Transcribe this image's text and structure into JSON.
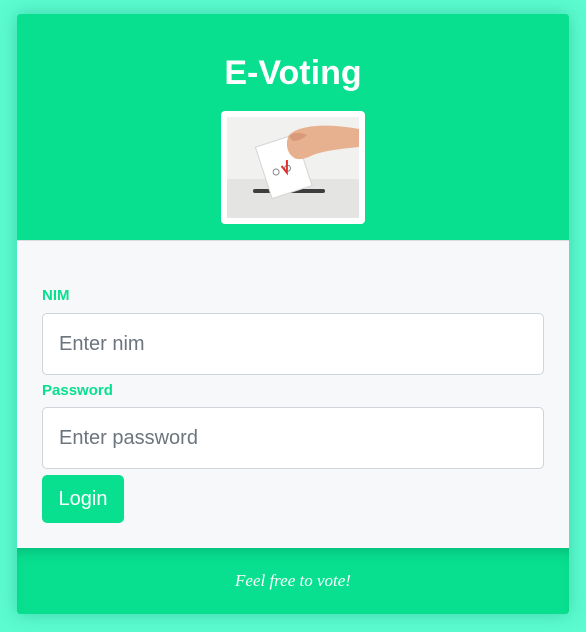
{
  "header": {
    "title": "E-Voting",
    "logo_icon": "ballot-box-icon"
  },
  "form": {
    "nim": {
      "label": "NIM",
      "placeholder": "Enter nim",
      "value": ""
    },
    "password": {
      "label": "Password",
      "placeholder": "Enter password",
      "value": ""
    },
    "login_label": "Login"
  },
  "footer": {
    "text": "Feel free to vote!"
  },
  "colors": {
    "background": "#5cfbd0",
    "accent": "#08e08f",
    "body": "#f7f8fa",
    "text_on_accent": "#ffffff"
  }
}
